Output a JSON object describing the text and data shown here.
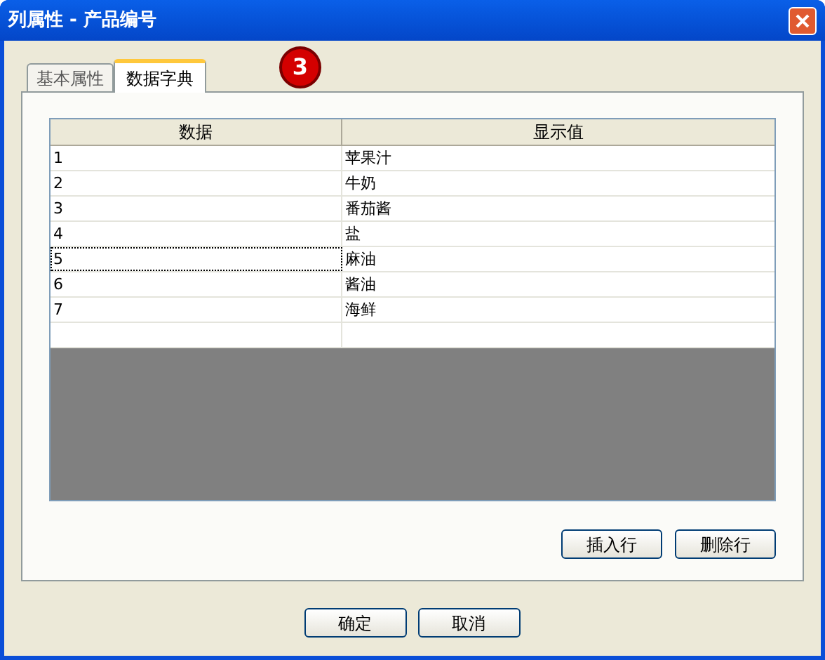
{
  "window": {
    "title": "列属性 - 产品编号"
  },
  "tabs": [
    {
      "label": "基本属性",
      "selected": false
    },
    {
      "label": "数据字典",
      "selected": true
    }
  ],
  "step_badge": "3",
  "table": {
    "columns": [
      "数据",
      "显示值"
    ],
    "rows": [
      {
        "cells": [
          "1",
          "苹果汁"
        ],
        "focused": false
      },
      {
        "cells": [
          "2",
          "牛奶"
        ],
        "focused": false
      },
      {
        "cells": [
          "3",
          "番茄酱"
        ],
        "focused": false
      },
      {
        "cells": [
          "4",
          "盐"
        ],
        "focused": false
      },
      {
        "cells": [
          "5",
          "麻油"
        ],
        "focused": true
      },
      {
        "cells": [
          "6",
          "酱油"
        ],
        "focused": false
      },
      {
        "cells": [
          "7",
          "海鲜"
        ],
        "focused": false
      },
      {
        "cells": [],
        "focused": false
      }
    ]
  },
  "table_buttons": [
    "插入行",
    "删除行"
  ],
  "dialog_buttons": [
    "确定",
    "取消"
  ]
}
